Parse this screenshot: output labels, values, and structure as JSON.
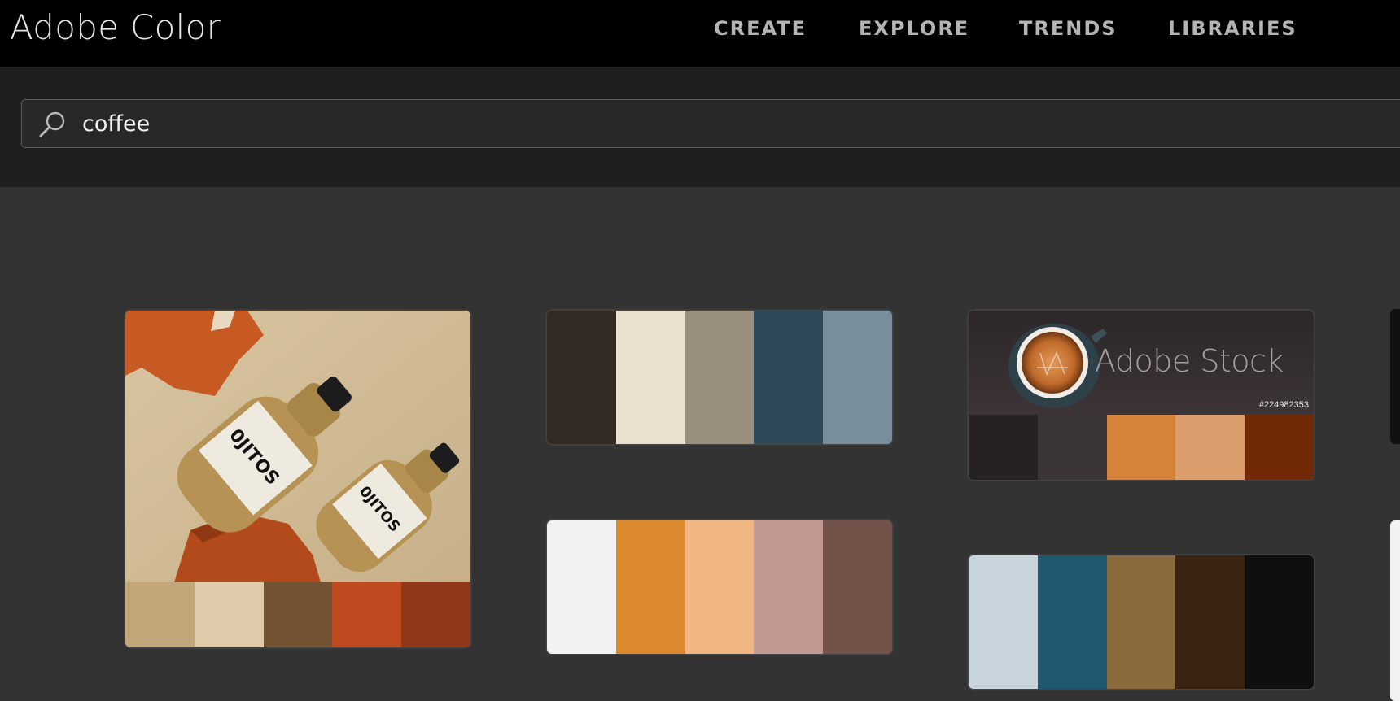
{
  "header": {
    "brand": "Adobe Color",
    "nav": [
      "CREATE",
      "EXPLORE",
      "TRENDS",
      "LIBRARIES"
    ]
  },
  "search": {
    "value": "coffee",
    "placeholder": "Search"
  },
  "cards": [
    {
      "kind": "image",
      "colors": [
        "#c2a77b",
        "#dfcaa9",
        "#735331",
        "#bf4a20",
        "#913719"
      ]
    },
    {
      "kind": "palette",
      "colors": [
        "#332a23",
        "#ebdfcd",
        "#9a8f7d",
        "#2e4a58",
        "#788e9c"
      ]
    },
    {
      "kind": "stock",
      "stock_label": "Adobe Stock",
      "stock_id": "#224982353",
      "colors": [
        "#252124",
        "#3b3438",
        "#d5833b",
        "#dc9d6d",
        "#722a06"
      ]
    },
    {
      "kind": "palette",
      "colors": [
        "#f2f2f2",
        "#da8a2c",
        "#f0b682",
        "#c19991",
        "#725249"
      ]
    },
    {
      "kind": "palette",
      "colors": [
        "#c7d4dc",
        "#205870",
        "#8b6a3e",
        "#3b2312",
        "#0f0f0f"
      ]
    }
  ]
}
